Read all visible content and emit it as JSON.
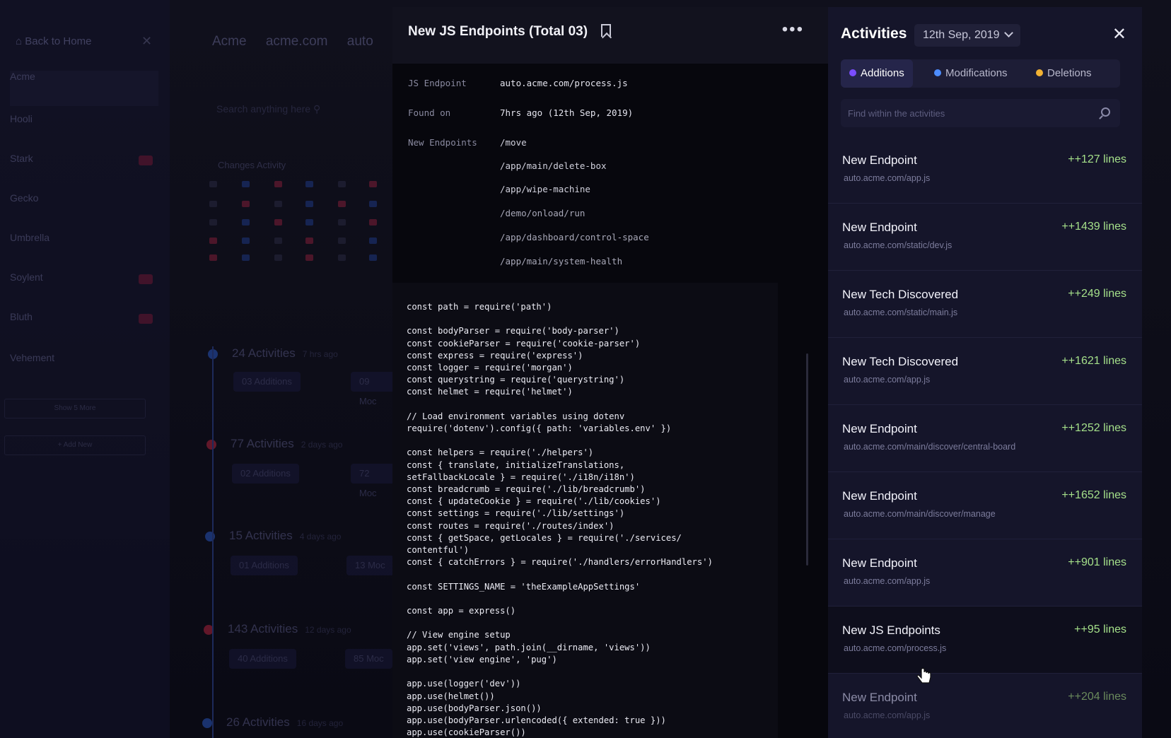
{
  "background": {
    "sidebar": {
      "back_label": "Back to Home",
      "items": [
        {
          "name": "Acme"
        },
        {
          "name": "Hooli"
        },
        {
          "name": "Stark"
        },
        {
          "name": "Gecko"
        },
        {
          "name": "Umbrella"
        },
        {
          "name": "Soylent"
        },
        {
          "name": "Bluth"
        },
        {
          "name": "Vehement"
        }
      ],
      "show_more": "Show 5 More",
      "add_new": "+ Add New"
    },
    "main": {
      "tabs": [
        "Acme",
        "acme.com",
        "auto"
      ],
      "search_placeholder": "Search anything here",
      "changes_label": "Changes Activity",
      "timeline": [
        {
          "count": "24 Activities",
          "when": "7 hrs ago",
          "chip1": "03 Additions",
          "chip2": "09 Moc"
        },
        {
          "count": "77 Activities",
          "when": "2 days ago",
          "chip1": "02 Additions",
          "chip2": "72 Moc"
        },
        {
          "count": "15 Activities",
          "when": "4 days ago",
          "chip1": "01 Additions",
          "chip2": "13 Moc"
        },
        {
          "count": "143 Activities",
          "when": "12 days ago",
          "chip1": "40 Additions",
          "chip2": "85 Moc"
        },
        {
          "count": "26 Activities",
          "when": "16 days ago"
        }
      ]
    }
  },
  "code_panel": {
    "title": "New JS Endpoints (Total 03)",
    "js_endpoint_label": "JS Endpoint",
    "js_endpoint_value": "auto.acme.com/process.js",
    "found_on_label": "Found on",
    "found_on_value": "7hrs ago (12th Sep, 2019)",
    "new_endpoints_label": "New Endpoints",
    "endpoints": [
      "/move",
      "/app/main/delete-box",
      "/app/wipe-machine",
      "/demo/onload/run",
      "/app/dashboard/control-space",
      "/app/main/system-health"
    ],
    "code": "const path = require('path')\n\nconst bodyParser = require('body-parser')\nconst cookieParser = require('cookie-parser')\nconst express = require('express')\nconst logger = require('morgan')\nconst querystring = require('querystring')\nconst helmet = require('helmet')\n\n// Load environment variables using dotenv\nrequire('dotenv').config({ path: 'variables.env' })\n\nconst helpers = require('./helpers')\nconst { translate, initializeTranslations,\nsetFallbackLocale } = require('./i18n/i18n')\nconst breadcrumb = require('./lib/breadcrumb')\nconst { updateCookie } = require('./lib/cookies')\nconst settings = require('./lib/settings')\nconst routes = require('./routes/index')\nconst { getSpace, getLocales } = require('./services/\ncontentful')\nconst { catchErrors } = require('./handlers/errorHandlers')\n\nconst SETTINGS_NAME = 'theExampleAppSettings'\n\nconst app = express()\n\n// View engine setup\napp.set('views', path.join(__dirname, 'views'))\napp.set('view engine', 'pug')\n\napp.use(logger('dev'))\napp.use(helmet())\napp.use(bodyParser.json())\napp.use(bodyParser.urlencoded({ extended: true }))\napp.use(cookieParser())"
  },
  "activities": {
    "title": "Activities",
    "date": "12th Sep, 2019",
    "tabs": [
      {
        "label": "Additions",
        "color": "#7b4dff"
      },
      {
        "label": "Modifications",
        "color": "#4d8dff"
      },
      {
        "label": "Deletions",
        "color": "#f2b233"
      }
    ],
    "search_placeholder": "Find within the activities",
    "items": [
      {
        "title": "New Endpoint",
        "url": "auto.acme.com/app.js",
        "lines": "++127 lines"
      },
      {
        "title": "New Endpoint",
        "url": "auto.acme.com/static/dev.js",
        "lines": "++1439 lines"
      },
      {
        "title": "New Tech Discovered",
        "url": "auto.acme.com/static/main.js",
        "lines": "++249 lines"
      },
      {
        "title": "New Tech Discovered",
        "url": "auto.acme.com/app.js",
        "lines": "++1621 lines"
      },
      {
        "title": "New Endpoint",
        "url": "auto.acme.com/main/discover/central-board",
        "lines": "++1252 lines"
      },
      {
        "title": "New Endpoint",
        "url": "auto.acme.com/main/discover/manage",
        "lines": "++1652 lines"
      },
      {
        "title": "New Endpoint",
        "url": "auto.acme.com/app.js",
        "lines": "++901 lines"
      },
      {
        "title": "New JS Endpoints",
        "url": "auto.acme.com/process.js",
        "lines": "++95 lines"
      },
      {
        "title": "New Endpoint",
        "url": "auto.acme.com/app.js",
        "lines": "++204 lines"
      }
    ]
  }
}
